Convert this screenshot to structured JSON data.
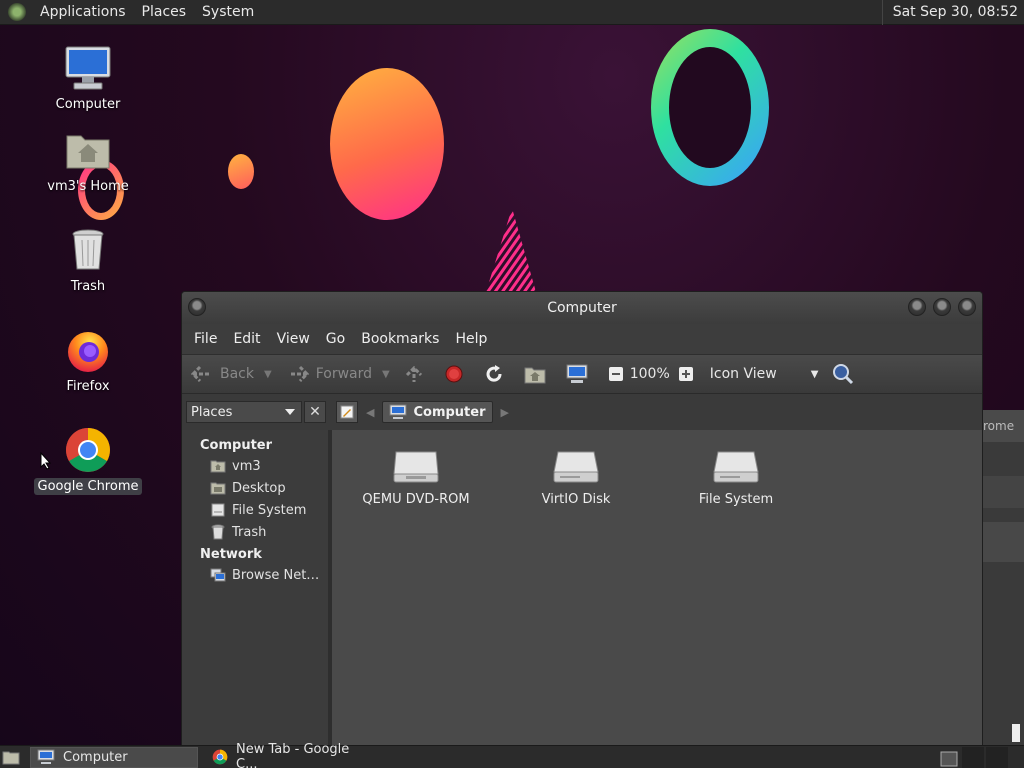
{
  "top_panel": {
    "menus": [
      "Applications",
      "Places",
      "System"
    ],
    "clock": "Sat Sep 30, 08:52"
  },
  "desktop": {
    "icons": [
      {
        "label": "Computer",
        "icon": "computer-icon"
      },
      {
        "label": "vm3's Home",
        "icon": "home-folder-icon"
      },
      {
        "label": "Trash",
        "icon": "trash-icon"
      },
      {
        "label": "Firefox",
        "icon": "firefox-icon"
      },
      {
        "label": "Google Chrome",
        "icon": "chrome-icon",
        "selected": true
      }
    ]
  },
  "bg_window": {
    "title_fragment": "rome"
  },
  "window": {
    "title": "Computer",
    "menubar": {
      "file": "File",
      "edit": "Edit",
      "view": "View",
      "go": "Go",
      "bookmarks": "Bookmarks",
      "help": "Help"
    },
    "toolbar": {
      "back": "Back",
      "forward": "Forward",
      "zoom": "100%",
      "view_mode": "Icon View"
    },
    "locbar": {
      "places_label": "Places",
      "crumb": "Computer"
    },
    "sidebar": {
      "computer_heading": "Computer",
      "computer_items": [
        {
          "label": "vm3",
          "icon": "home-folder-icon"
        },
        {
          "label": "Desktop",
          "icon": "desktop-folder-icon"
        },
        {
          "label": "File System",
          "icon": "drive-icon"
        },
        {
          "label": "Trash",
          "icon": "trash-icon"
        }
      ],
      "network_heading": "Network",
      "network_items": [
        {
          "label": "Browse Net…",
          "icon": "network-icon"
        }
      ]
    },
    "volumes": [
      {
        "label": "QEMU DVD-ROM",
        "icon": "optical-drive-icon"
      },
      {
        "label": "VirtIO Disk",
        "icon": "hard-disk-icon"
      },
      {
        "label": "File System",
        "icon": "hard-disk-icon"
      }
    ]
  },
  "taskbar": {
    "tasks": [
      {
        "label": "Computer",
        "icon": "computer-icon",
        "active": true
      },
      {
        "label": "New Tab - Google C...",
        "icon": "chrome-icon",
        "active": false
      }
    ]
  },
  "colors": {
    "accent_orange": "#ff6a4a",
    "accent_pink": "#ff2e8a",
    "ring_green": "#9be15d",
    "ring_blue": "#3aa0ff",
    "panel": "#2b2b2b",
    "window_bg": "#444444"
  }
}
